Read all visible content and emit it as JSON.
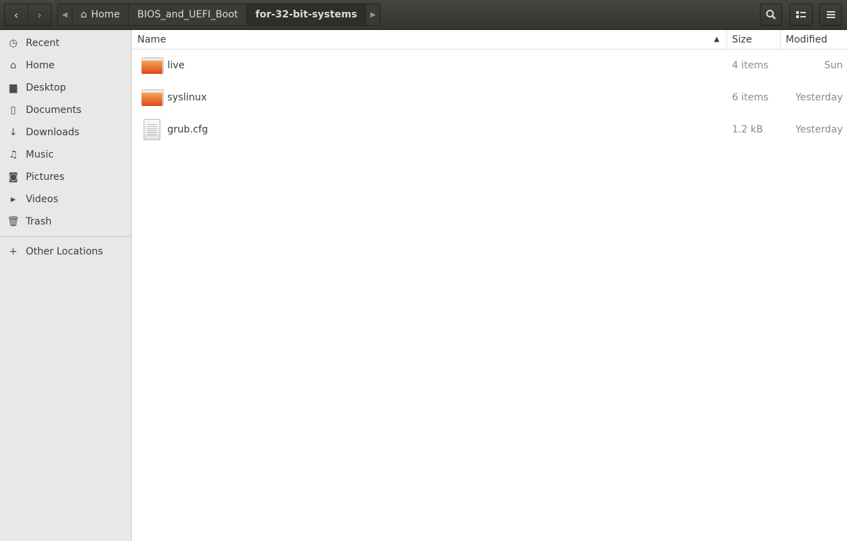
{
  "header": {
    "back_icon": "chevron-left",
    "forward_icon": "chevron-right",
    "breadcrumb": [
      {
        "label": "Home",
        "icon": "home-icon"
      },
      {
        "label": "BIOS_and_UEFI_Boot"
      },
      {
        "label": "for-32-bit-systems",
        "current": true
      }
    ],
    "search_icon": "search",
    "view_icon": "list-view",
    "menu_icon": "hamburger"
  },
  "sidebar": {
    "items": [
      {
        "label": "Recent",
        "icon": "clock"
      },
      {
        "label": "Home",
        "icon": "home"
      },
      {
        "label": "Desktop",
        "icon": "folder"
      },
      {
        "label": "Documents",
        "icon": "document"
      },
      {
        "label": "Downloads",
        "icon": "download"
      },
      {
        "label": "Music",
        "icon": "music"
      },
      {
        "label": "Pictures",
        "icon": "camera"
      },
      {
        "label": "Videos",
        "icon": "video"
      },
      {
        "label": "Trash",
        "icon": "trash"
      }
    ],
    "other": "Other Locations"
  },
  "columns": {
    "name": "Name",
    "size": "Size",
    "modified": "Modified",
    "sort": "ascending"
  },
  "files": [
    {
      "name": "live",
      "type": "folder",
      "size": "4 items",
      "modified": "Sun"
    },
    {
      "name": "syslinux",
      "type": "folder",
      "size": "6 items",
      "modified": "Yesterday"
    },
    {
      "name": "grub.cfg",
      "type": "file",
      "size": "1.2 kB",
      "modified": "Yesterday"
    }
  ],
  "colors": {
    "header": "#3c3b37",
    "folder": "#e95420",
    "sidebar": "#e8e8e7"
  }
}
